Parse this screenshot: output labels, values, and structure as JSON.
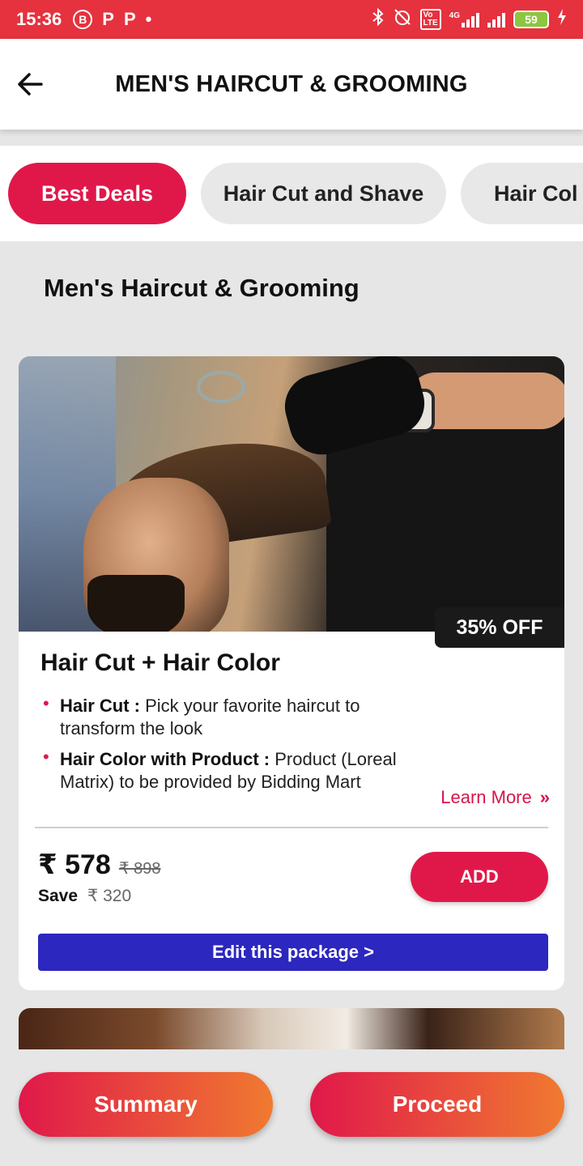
{
  "status_bar": {
    "time": "15:36",
    "indicators": [
      "B",
      "P",
      "P",
      "•"
    ],
    "battery": "59",
    "network": "4G",
    "volte": "VoLTE"
  },
  "app_bar": {
    "title": "MEN'S HAIRCUT & GROOMING"
  },
  "tabs": [
    {
      "label": "Best Deals",
      "active": true
    },
    {
      "label": "Hair Cut and Shave",
      "active": false
    },
    {
      "label": "Hair Col",
      "active": false
    }
  ],
  "section": {
    "title": "Men's Haircut & Grooming"
  },
  "package": {
    "discount_badge": "35% OFF",
    "title": "Hair Cut + Hair Color",
    "features": [
      {
        "name": "Hair Cut :",
        "description": "Pick your favorite haircut to transform the look"
      },
      {
        "name": "Hair Color with Product :",
        "description": "Product (Loreal Matrix) to be provided by Bidding Mart"
      }
    ],
    "learn_more_label": "Learn More",
    "learn_more_chevron": "»",
    "price_now": "₹ 578",
    "price_was": "₹ 898",
    "save_label": "Save",
    "save_amount": "₹ 320",
    "add_label": "ADD",
    "edit_label": "Edit this package >"
  },
  "bottom_actions": {
    "summary_label": "Summary",
    "proceed_label": "Proceed"
  },
  "colors": {
    "status_bar": "#e5323e",
    "accent": "#e0184a",
    "edit_button": "#2b27bf",
    "gradient_end": "#f07a30"
  }
}
